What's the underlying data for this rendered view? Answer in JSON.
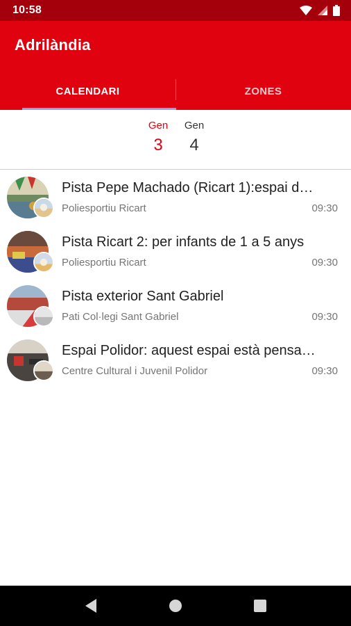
{
  "status_bar": {
    "time": "10:58",
    "icons": [
      "wifi-icon",
      "signal-icon",
      "battery-icon"
    ]
  },
  "app": {
    "title": "Adrilàndia",
    "primary_color": "#e0030f",
    "status_color": "#a3000b"
  },
  "tabs": [
    {
      "label": "CALENDARI",
      "selected": true
    },
    {
      "label": "ZONES",
      "selected": false
    }
  ],
  "dates": [
    {
      "month": "Gen",
      "day": "3",
      "selected": true
    },
    {
      "month": "Gen",
      "day": "4",
      "selected": false
    }
  ],
  "events": [
    {
      "title": "Pista Pepe Machado (Ricart 1):espai d…",
      "place": "Poliesportiu Ricart",
      "time": "09:30"
    },
    {
      "title": "Pista Ricart 2: per infants de 1 a 5 anys",
      "place": "Poliesportiu Ricart",
      "time": "09:30"
    },
    {
      "title": "Pista exterior Sant Gabriel",
      "place": "Pati Col·legi Sant Gabriel",
      "time": "09:30"
    },
    {
      "title": "Espai Polidor: aquest espai està pensa…",
      "place": "Centre Cultural i Juvenil Polidor",
      "time": "09:30"
    }
  ],
  "nav": {
    "icons": [
      "back-icon",
      "home-icon",
      "recents-icon"
    ]
  }
}
